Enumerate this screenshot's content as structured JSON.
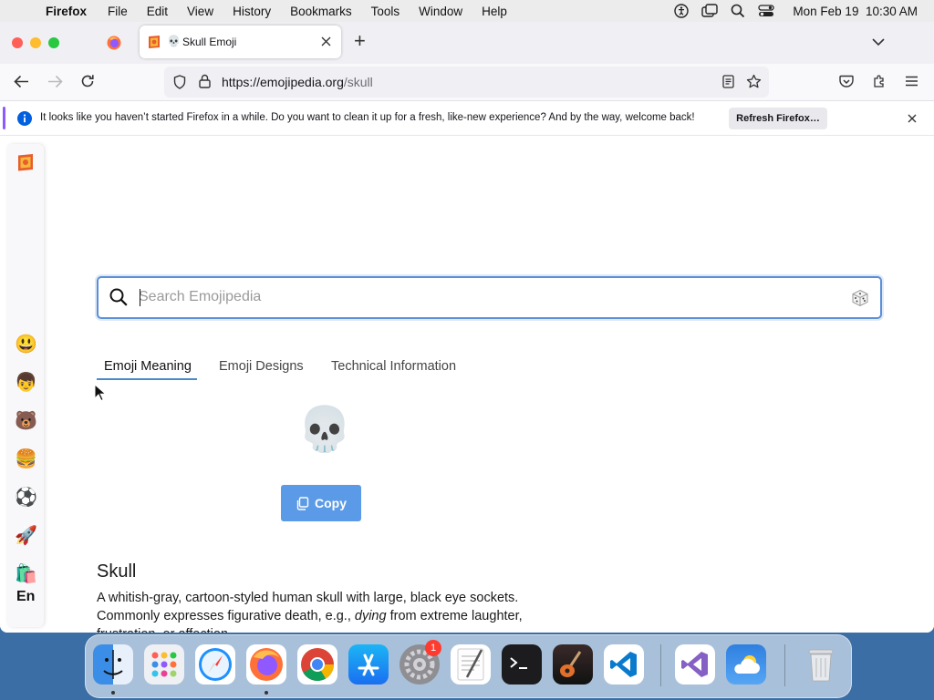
{
  "menubar": {
    "app": "Firefox",
    "items": [
      "File",
      "Edit",
      "View",
      "History",
      "Bookmarks",
      "Tools",
      "Window",
      "Help"
    ],
    "datetime": "Mon Feb 19  10:30 AM"
  },
  "browser": {
    "tab_title": "Skull Emoji",
    "tab_title_emoji": "💀",
    "new_tab_symbol": "+",
    "url_host": "https://emojipedia.org",
    "url_path": "/skull",
    "notification": {
      "text": "It looks like you haven’t started Firefox in a while. Do you want to clean it up for a fresh, like-new experience? And by the way, welcome back!",
      "button": "Refresh Firefox…"
    }
  },
  "sidebar": {
    "emojis": [
      "😃",
      "👦",
      "🐻",
      "🍔",
      "⚽",
      "🚀",
      "🛍️"
    ],
    "language": "En"
  },
  "search": {
    "placeholder": "Search Emojipedia"
  },
  "tabs": [
    {
      "label": "Emoji Meaning",
      "active": true
    },
    {
      "label": "Emoji Designs",
      "active": false
    },
    {
      "label": "Technical Information",
      "active": false
    }
  ],
  "emoji": {
    "glyph": "💀",
    "copy_label": "Copy",
    "name": "Skull",
    "description_1": "A whitish-gray, cartoon-styled human skull with large, black eye sockets. Commonly expresses figurative death, e.g., ",
    "description_em": "dying",
    "description_2": " from extreme laughter, frustration, or affection."
  },
  "dock": {
    "apps": [
      "Finder",
      "Launchpad",
      "Safari",
      "Firefox",
      "Chrome",
      "App Store",
      "System Settings",
      "TextEdit",
      "Terminal",
      "Instruments",
      "Visual Studio Code",
      "Visual Studio",
      "Weather",
      "Trash"
    ],
    "settings_badge": "1"
  },
  "colors": {
    "accent": "#5b8fd8",
    "copy_button": "#5b9ae6",
    "firefox_purple": "#9059ff"
  }
}
